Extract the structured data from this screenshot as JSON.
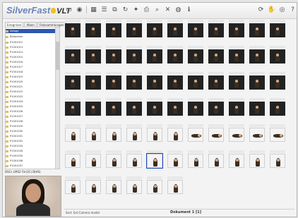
{
  "app": {
    "logo": "SilverFast",
    "logo_suffix": "VLT"
  },
  "toolbar_icons": [
    "view-icon",
    "selection-icon",
    "grid-icon",
    "list-icon",
    "filter-icon",
    "rotate-icon",
    "star-icon",
    "print-icon",
    "search-icon",
    "delete-icon",
    "scan-icon",
    "info-icon"
  ],
  "right_icons": [
    "refresh-icon",
    "hand-icon",
    "eye-icon",
    "help-icon"
  ],
  "tabs": [
    "Ereignisse",
    "Alben",
    "Fotosammlungen"
  ],
  "tree": {
    "root": "Ablage",
    "folder": "Bildordner",
    "items": [
      "P1001012",
      "P1001013",
      "P1001014",
      "P1001015",
      "P1001016",
      "P1001017",
      "P1001018",
      "P1001019",
      "P1001020",
      "P1001021",
      "P1001022",
      "P1001023",
      "P1001024",
      "P1001025",
      "P1001026",
      "P1001027",
      "P1001028",
      "P1001029",
      "P1001030",
      "P1001031",
      "P1001032",
      "P1001033",
      "P1001034",
      "P1001035",
      "P1001036",
      "P1001037"
    ]
  },
  "preview_info": "DSCs LMS2 Fin(3C) B(HS)",
  "status": {
    "left": "Sort: Ext Camera model",
    "center": "Dokument 1 [1]"
  }
}
